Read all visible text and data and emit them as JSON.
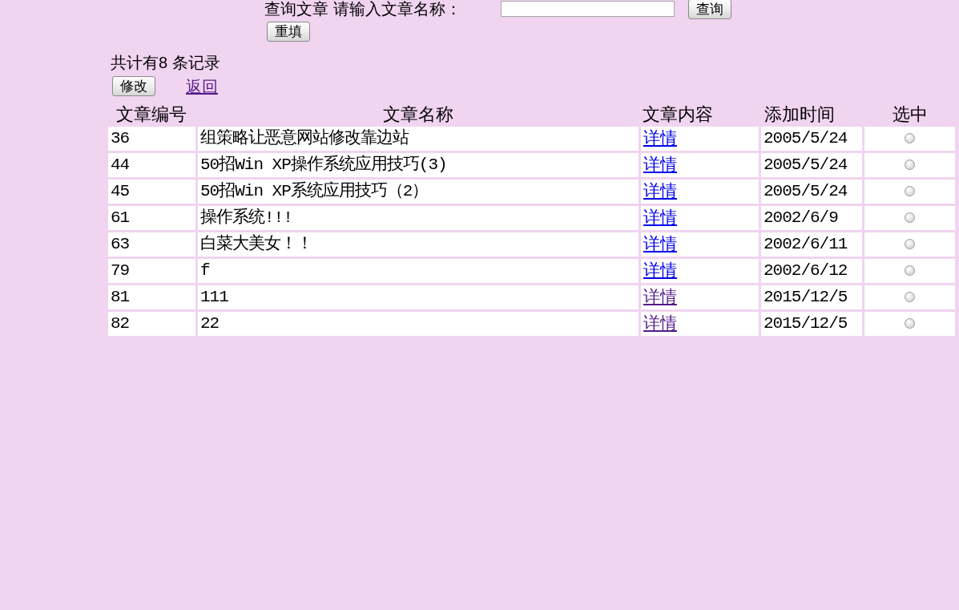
{
  "search": {
    "label": "查询文章 请输入文章名称：",
    "search_button": "查询",
    "reset_button": "重填"
  },
  "summary": "共计有8 条记录",
  "actions": {
    "edit_button": "修改",
    "back_link": {
      "label": "返回",
      "visited": true
    }
  },
  "table": {
    "columns": [
      "文章编号",
      "文章名称",
      "文章内容",
      "添加时间",
      "选中"
    ],
    "rows": [
      {
        "id": "36",
        "title": "组策略让恶意网站修改靠边站",
        "detail": {
          "label": "详情",
          "visited": false
        },
        "date": "2005/5/24",
        "selected": false
      },
      {
        "id": "44",
        "title": "50招Win XP操作系统应用技巧(3)",
        "detail": {
          "label": "详情",
          "visited": false
        },
        "date": "2005/5/24",
        "selected": false
      },
      {
        "id": "45",
        "title": "50招Win XP系统应用技巧（2）",
        "detail": {
          "label": "详情",
          "visited": false
        },
        "date": "2005/5/24",
        "selected": false
      },
      {
        "id": "61",
        "title": "操作系统!!!",
        "detail": {
          "label": "详情",
          "visited": false
        },
        "date": "2002/6/9",
        "selected": false
      },
      {
        "id": "63",
        "title": "白菜大美女！！",
        "detail": {
          "label": "详情",
          "visited": false
        },
        "date": "2002/6/11",
        "selected": false
      },
      {
        "id": "79",
        "title": "f",
        "detail": {
          "label": "详情",
          "visited": false
        },
        "date": "2002/6/12",
        "selected": false
      },
      {
        "id": "81",
        "title": "111",
        "detail": {
          "label": "详情",
          "visited": true
        },
        "date": "2015/12/5",
        "selected": false
      },
      {
        "id": "82",
        "title": "22",
        "detail": {
          "label": "详情",
          "visited": true
        },
        "date": "2015/12/5",
        "selected": false
      }
    ]
  }
}
